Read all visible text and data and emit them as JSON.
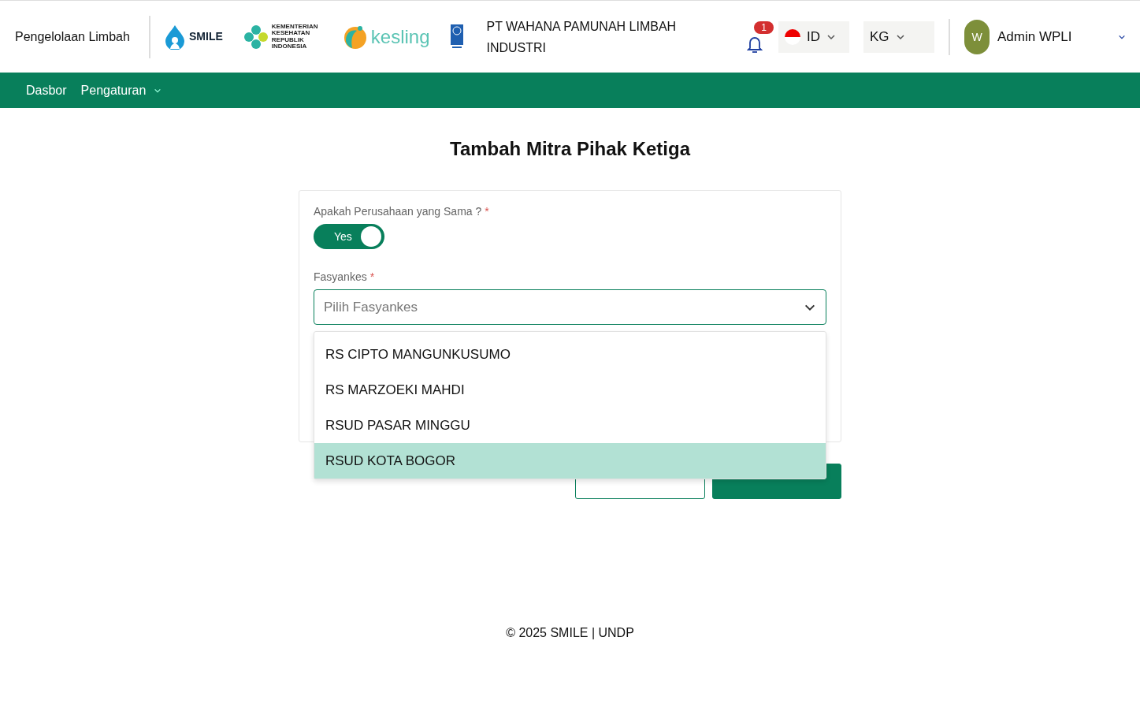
{
  "header": {
    "app_title": "Pengelolaan Limbah",
    "logos": [
      {
        "kind": "smile",
        "text": "SMILE"
      },
      {
        "kind": "kemenkes",
        "text": "KEMENTERIAN KESEHATAN REPUBLIK INDONESIA"
      },
      {
        "kind": "kesling",
        "text": "kesling"
      },
      {
        "kind": "undp"
      }
    ],
    "company": "PT WAHANA PAMUNAH LIMBAH INDUSTRI",
    "notification_count": "1",
    "language": "ID",
    "unit": "KG",
    "user": {
      "initial": "W",
      "name": "Admin WPLI"
    }
  },
  "nav": [
    {
      "label": "Dasbor",
      "has_menu": false
    },
    {
      "label": "Pengaturan",
      "has_menu": true
    }
  ],
  "page_title": "Tambah Mitra Pihak Ketiga",
  "form": {
    "same_company": {
      "label": "Apakah Perusahaan yang Sama ?",
      "required_mark": "*",
      "on": true,
      "on_text": "Yes"
    },
    "fasyankes": {
      "label": "Fasyankes",
      "required_mark": "*",
      "placeholder": "Pilih Fasyankes",
      "expanded": true,
      "options": [
        {
          "label": "RS CIPTO MANGUNKUSUMO",
          "selected": false
        },
        {
          "label": "RS MARZOEKI MAHDI",
          "selected": false
        },
        {
          "label": "RSUD PASAR MINGGU",
          "selected": false
        },
        {
          "label": "RSUD KOTA BOGOR",
          "selected": true
        }
      ]
    },
    "buttons": [
      {
        "kind": "secondary"
      },
      {
        "kind": "primary"
      }
    ]
  },
  "footer": "© 2025 SMILE | UNDP"
}
